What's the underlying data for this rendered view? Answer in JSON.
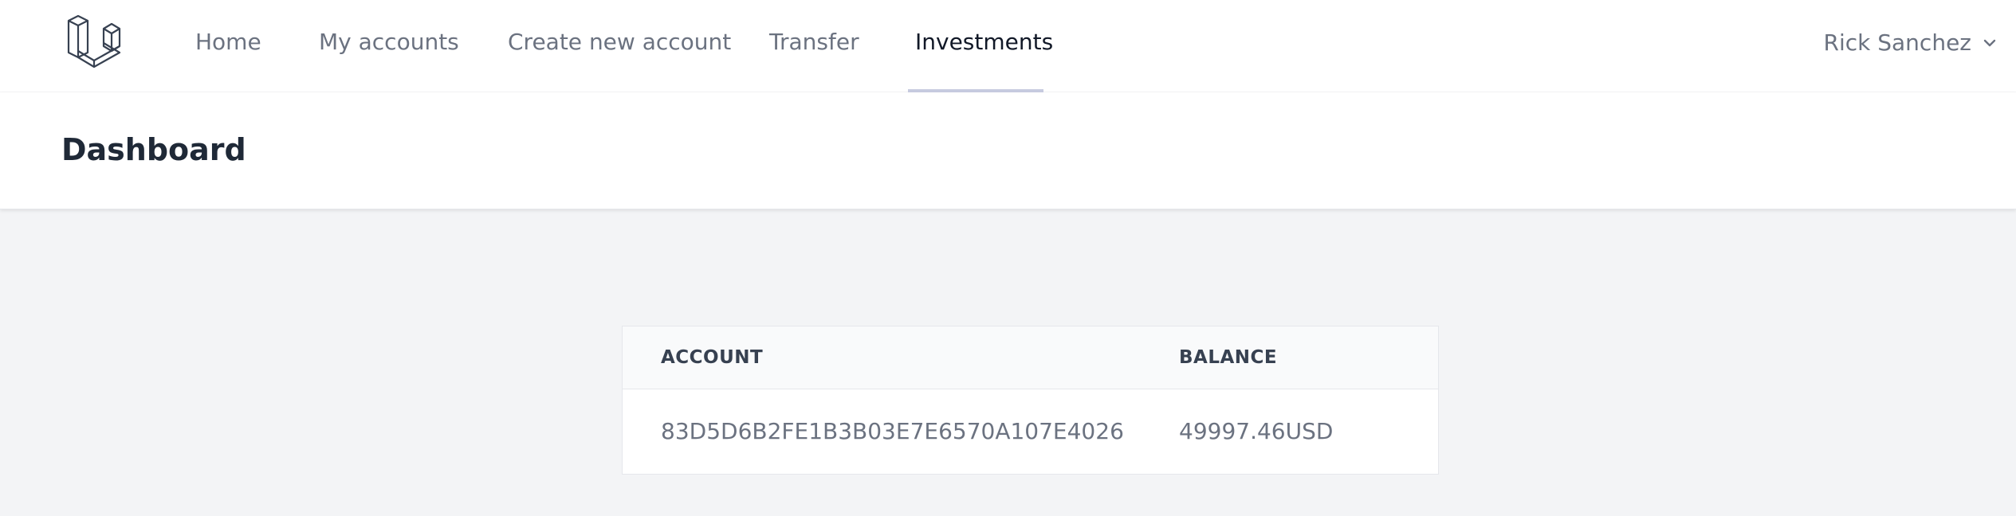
{
  "nav": {
    "logo_icon": "laravel-logo-icon",
    "links": [
      {
        "label": "Home",
        "active": false
      },
      {
        "label": "My accounts",
        "active": false
      },
      {
        "label": "Create new account",
        "active": false
      },
      {
        "label": "Transfer",
        "active": false
      },
      {
        "label": "Investments",
        "active": true
      }
    ],
    "user": {
      "name": "Rick Sanchez",
      "icon": "chevron-down-icon"
    }
  },
  "header": {
    "title": "Dashboard"
  },
  "table": {
    "columns": [
      "ACCOUNT",
      "BALANCE"
    ],
    "rows": [
      {
        "account": "83D5D6B2FE1B3B03E7E6570A107E4026",
        "balance": "49997.46USD"
      }
    ]
  },
  "colors": {
    "background": "#f3f4f6",
    "surface": "#ffffff",
    "text_muted": "#6b7280",
    "text_active": "#111827",
    "active_underline": "#c7cbe0"
  }
}
